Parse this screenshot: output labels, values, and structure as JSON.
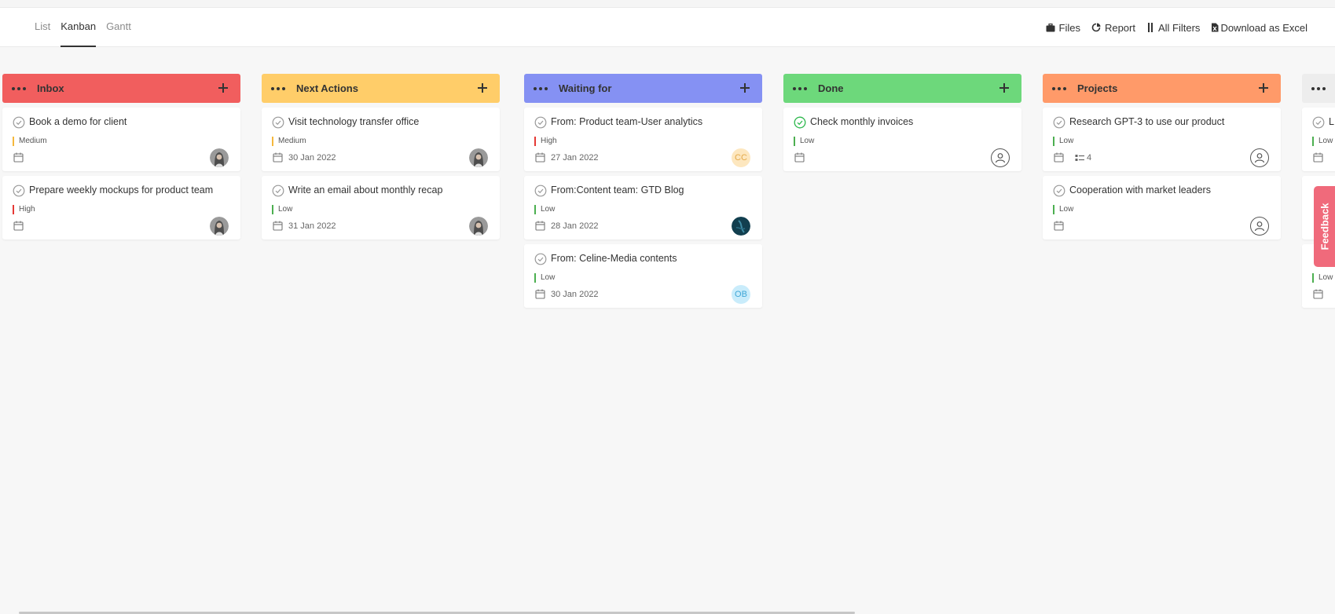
{
  "tabs": [
    {
      "label": "List",
      "active": false
    },
    {
      "label": "Kanban",
      "active": true
    },
    {
      "label": "Gantt",
      "active": false
    }
  ],
  "actions": {
    "files": "Files",
    "report": "Report",
    "filters": "All Filters",
    "download": "Download as Excel"
  },
  "colors": {
    "inbox": "#f15e5e",
    "next_actions": "#ffcd69",
    "waiting_for": "#8591f3",
    "done": "#6dd87b",
    "projects": "#ff9a69",
    "partial": "#ededed",
    "high": "#e53935",
    "medium": "#f5b83d",
    "low": "#4caf50"
  },
  "columns": [
    {
      "title": "Inbox",
      "cards": [
        {
          "title": "Book a demo for client",
          "priority": "Medium",
          "date": "",
          "avatar": "photo"
        },
        {
          "title": "Prepare weekly mockups for product team",
          "priority": "High",
          "date": "",
          "avatar": "photo"
        }
      ]
    },
    {
      "title": "Next Actions",
      "cards": [
        {
          "title": "Visit technology transfer office",
          "priority": "Medium",
          "date": "30 Jan 2022",
          "avatar": "photo"
        },
        {
          "title": "Write an email about monthly recap",
          "priority": "Low",
          "date": "31 Jan 2022",
          "avatar": "photo"
        }
      ]
    },
    {
      "title": "Waiting for",
      "cards": [
        {
          "title": "From: Product team-User analytics",
          "priority": "High",
          "date": "27 Jan 2022",
          "avatar": "CC"
        },
        {
          "title": "From:Content team: GTD Blog",
          "priority": "Low",
          "date": "28 Jan 2022",
          "avatar": "dark"
        },
        {
          "title": "From: Celine-Media contents",
          "priority": "Low",
          "date": "30 Jan 2022",
          "avatar": "OB"
        }
      ]
    },
    {
      "title": "Done",
      "cards": [
        {
          "title": "Check monthly invoices",
          "priority": "Low",
          "date": "",
          "avatar": "empty",
          "completed": true
        }
      ]
    },
    {
      "title": "Projects",
      "cards": [
        {
          "title": "Research GPT-3 to use our product",
          "priority": "Low",
          "date": "",
          "avatar": "empty",
          "subtasks": "4"
        },
        {
          "title": "Cooperation with market leaders",
          "priority": "Low",
          "date": "",
          "avatar": "empty"
        }
      ]
    },
    {
      "title": "",
      "partial": true,
      "cards": [
        {
          "title": "L",
          "priority": "Low",
          "date": "",
          "avatar": ""
        },
        {
          "title": "",
          "priority": "",
          "date": "",
          "avatar": ""
        },
        {
          "title": "",
          "priority": "Low",
          "date": "",
          "avatar": ""
        }
      ]
    }
  ],
  "feedback": "Feedback"
}
